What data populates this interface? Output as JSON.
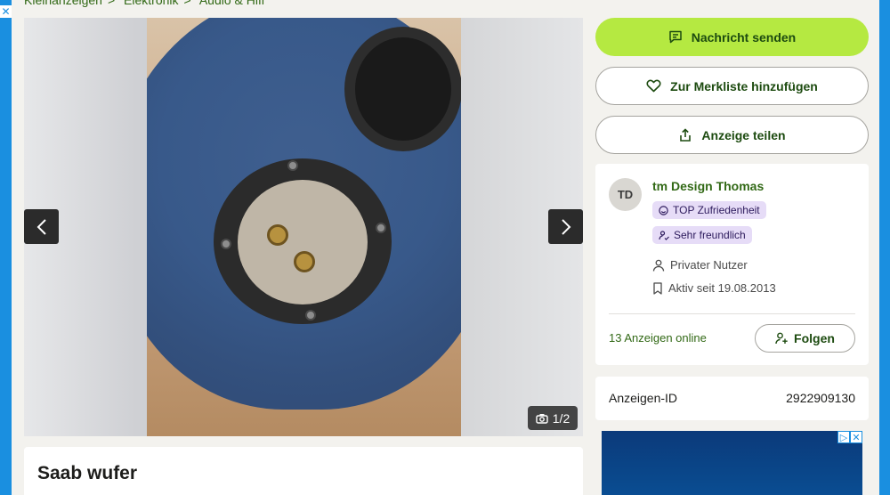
{
  "breadcrumb": [
    "Kleinanzeigen",
    "Elektronik",
    "Audio & Hifi"
  ],
  "breadcrumb_sep": ">",
  "gallery": {
    "counter": "1/2"
  },
  "listing": {
    "title": "Saab wufer",
    "id_label": "Anzeigen-ID",
    "id_value": "2922909130"
  },
  "actions": {
    "message": "Nachricht senden",
    "watchlist": "Zur Merkliste hinzufügen",
    "share": "Anzeige teilen"
  },
  "seller": {
    "initials": "TD",
    "name": "tm Design Thomas",
    "badges": [
      "TOP Zufriedenheit",
      "Sehr freundlich"
    ],
    "type": "Privater Nutzer",
    "active_since": "Aktiv seit 19.08.2013",
    "ads_online": "13 Anzeigen online",
    "follow_label": "Folgen"
  },
  "ad_close": "✕",
  "colors": {
    "accent_green": "#b5e941",
    "link_green": "#326916",
    "badge_bg": "#e6dcf7",
    "ad_blue": "#1a8fe0"
  }
}
